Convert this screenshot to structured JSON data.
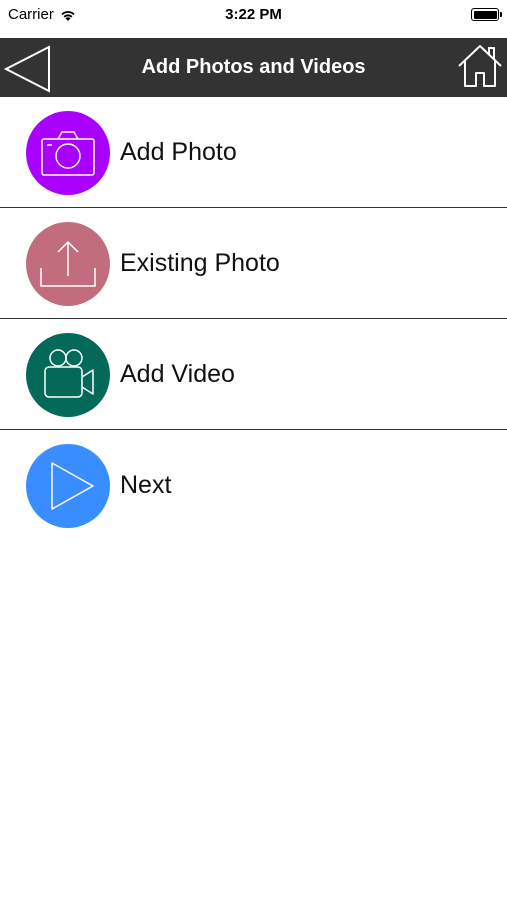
{
  "status_bar": {
    "carrier": "Carrier",
    "time": "3:22 PM"
  },
  "nav": {
    "title": "Add Photos and Videos",
    "back_icon": "back-triangle-icon",
    "home_icon": "home-icon"
  },
  "menu": {
    "items": [
      {
        "label": "Add Photo",
        "icon": "camera-icon",
        "color": "#aa00ff"
      },
      {
        "label": "Existing Photo",
        "icon": "upload-icon",
        "color": "#c26d7e"
      },
      {
        "label": "Add Video",
        "icon": "video-camera-icon",
        "color": "#036a5a"
      },
      {
        "label": "Next",
        "icon": "play-icon",
        "color": "#3a8dff"
      }
    ]
  }
}
